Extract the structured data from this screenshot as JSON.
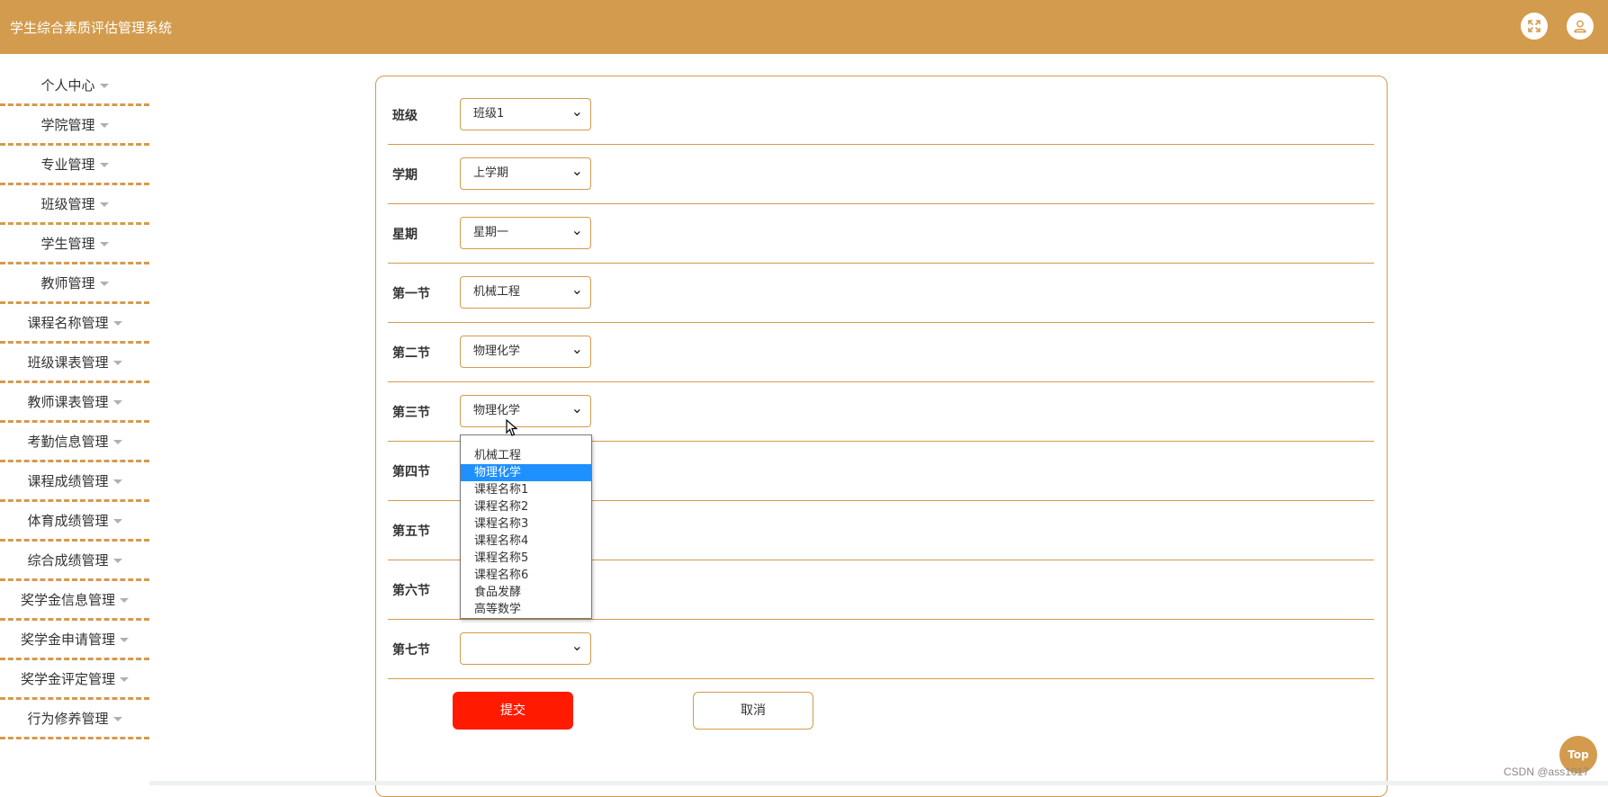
{
  "header": {
    "title": "学生综合素质评估管理系统",
    "fullscreen_icon": "expand-arrows-icon",
    "user_icon": "user-icon",
    "bg_color": "#d39b4d"
  },
  "sidebar": {
    "items": [
      {
        "label": "个人中心"
      },
      {
        "label": "学院管理"
      },
      {
        "label": "专业管理"
      },
      {
        "label": "班级管理"
      },
      {
        "label": "学生管理"
      },
      {
        "label": "教师管理"
      },
      {
        "label": "课程名称管理"
      },
      {
        "label": "班级课表管理"
      },
      {
        "label": "教师课表管理"
      },
      {
        "label": "考勤信息管理"
      },
      {
        "label": "课程成绩管理"
      },
      {
        "label": "体育成绩管理"
      },
      {
        "label": "综合成绩管理"
      },
      {
        "label": "奖学金信息管理"
      },
      {
        "label": "奖学金申请管理"
      },
      {
        "label": "奖学金评定管理"
      },
      {
        "label": "行为修养管理"
      }
    ]
  },
  "form": {
    "rows": [
      {
        "label": "班级",
        "value": "班级1"
      },
      {
        "label": "学期",
        "value": "上学期"
      },
      {
        "label": "星期",
        "value": "星期一"
      },
      {
        "label": "第一节",
        "value": "机械工程"
      },
      {
        "label": "第二节",
        "value": "物理化学"
      },
      {
        "label": "第三节",
        "value": "物理化学"
      },
      {
        "label": "第四节",
        "value": ""
      },
      {
        "label": "第五节",
        "value": ""
      },
      {
        "label": "第六节",
        "value": ""
      },
      {
        "label": "第七节",
        "value": ""
      }
    ],
    "submit_label": "提交",
    "cancel_label": "取消"
  },
  "dropdown": {
    "selected": "物理化学",
    "options": [
      "",
      "机械工程",
      "物理化学",
      "课程名称1",
      "课程名称2",
      "课程名称3",
      "课程名称4",
      "课程名称5",
      "课程名称6",
      "食品发酵",
      "高等数学"
    ]
  },
  "top_button_label": "Top",
  "watermark": "CSDN @ass1017",
  "colors": {
    "accent": "#d39b4d",
    "submit": "#ff1a00",
    "selected_option": "#1e90ff"
  }
}
